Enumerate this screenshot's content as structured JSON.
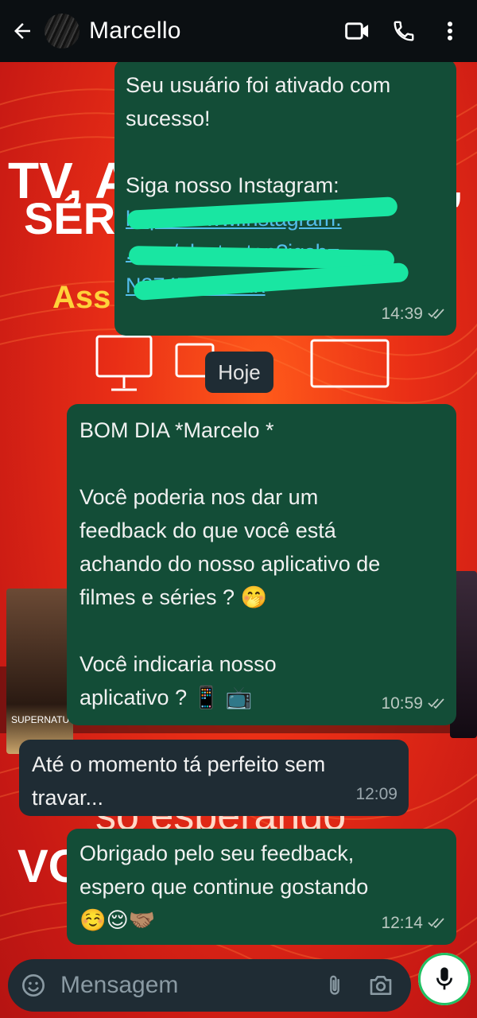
{
  "header": {
    "contact_name": "Marcello",
    "icons": [
      "back-arrow-icon",
      "video-call-icon",
      "phone-icon",
      "more-vert-icon"
    ]
  },
  "wallpaper": {
    "line1": "TV, A",
    "line1_end": ",",
    "line2": "SÉRI",
    "accent": "Ass",
    "poster_text_left": "SUPERNATU",
    "bottom_text": "só esperando",
    "bottom_text_left": "VO"
  },
  "day_separator": "Hoje",
  "messages": [
    {
      "direction": "outgoing",
      "text_before_link": "Seu usuário foi ativado com\nsucesso!\n\nSiga nosso Instagram:",
      "link_text": "https://www.instagram.\n.com/playtv_ton?igsh=\nN3747...FZDIx",
      "time": "14:39",
      "status": "read"
    },
    {
      "direction": "outgoing",
      "text": "BOM DIA *Marcelo *\n\nVocê poderia nos dar um\nfeedback do que você está\nachando do nosso aplicativo de\nfilmes e séries ? 🤭\n\nVocê indicaria nosso\naplicativo ? 📱 📺",
      "time": "10:59",
      "status": "read"
    },
    {
      "direction": "incoming",
      "text": "Até o momento tá perfeito sem\ntravar...",
      "time": "12:09"
    },
    {
      "direction": "outgoing",
      "text": "Obrigado pelo seu feedback,\nespero que continue gostando\n☺️😌🤝🏽",
      "time": "12:14",
      "status": "read"
    }
  ],
  "composer": {
    "placeholder": "Mensagem",
    "icons": [
      "emoji-icon",
      "attach-icon",
      "camera-icon",
      "mic-icon"
    ]
  },
  "colors": {
    "outgoing_bubble": "#134d37",
    "incoming_bubble": "#1f2c34",
    "header": "#0b0f12",
    "read_tick": "#b9c7c0",
    "link": "#53bdeb",
    "wallpaper_red": "#e92e16"
  }
}
